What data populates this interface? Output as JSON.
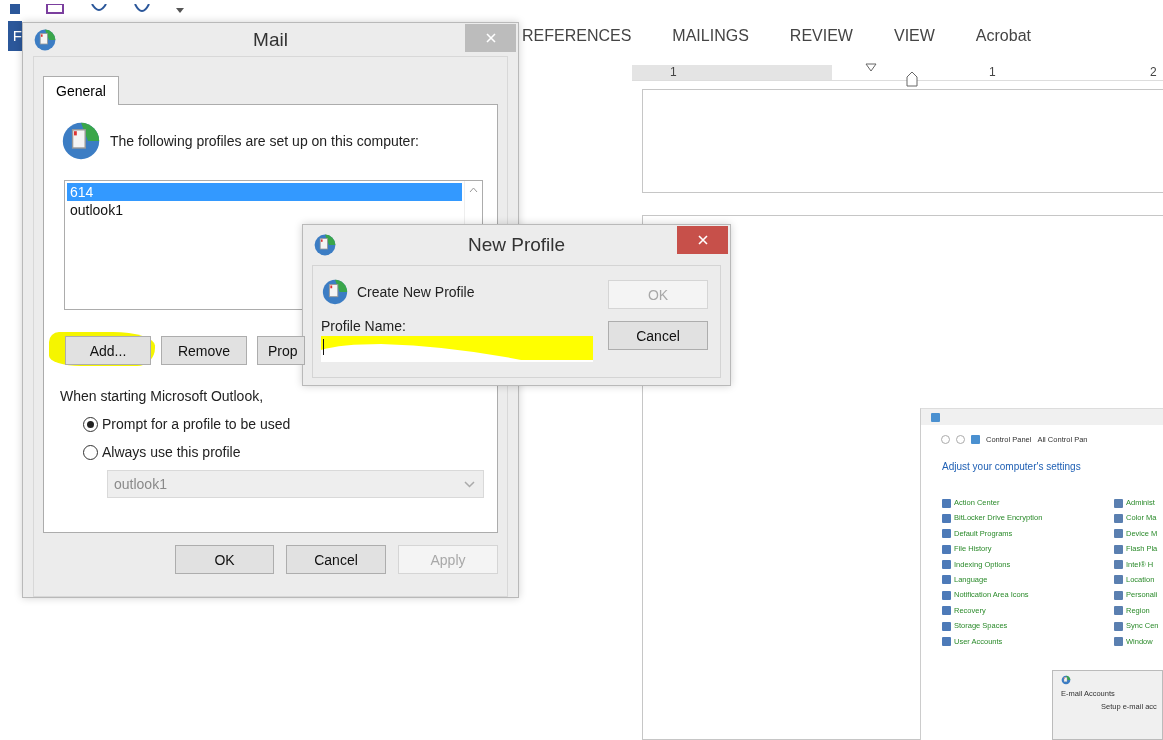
{
  "word": {
    "ribbon_tabs": [
      {
        "label": "F",
        "selected": true
      },
      {
        "label": "REFERENCES",
        "selected": false
      },
      {
        "label": "MAILINGS",
        "selected": false
      },
      {
        "label": "REVIEW",
        "selected": false
      },
      {
        "label": "VIEW",
        "selected": false
      },
      {
        "label": "Acrobat",
        "selected": false
      }
    ],
    "ruler_numbers": [
      "1",
      "1",
      "2"
    ]
  },
  "mail_dialog": {
    "title": "Mail",
    "active": false,
    "tabs": [
      {
        "label": "General",
        "selected": true
      }
    ],
    "intro": "The following profiles are set up on this computer:",
    "profiles": [
      {
        "name": "614",
        "selected": true
      },
      {
        "name": "outlook1",
        "selected": false
      }
    ],
    "buttons": [
      {
        "label": "Add...",
        "highlighted": true
      },
      {
        "label": "Remove",
        "highlighted": false
      },
      {
        "label": "Prop",
        "highlighted": false
      }
    ],
    "startup_label": "When starting Microsoft Outlook,",
    "options": [
      {
        "label": "Prompt for a profile to be used",
        "selected": true
      },
      {
        "label": "Always use this profile",
        "selected": false
      }
    ],
    "profile_select": {
      "value": "outlook1",
      "disabled": true
    },
    "footer_buttons": [
      {
        "label": "OK",
        "disabled": false
      },
      {
        "label": "Cancel",
        "disabled": false
      },
      {
        "label": "Apply",
        "disabled": true
      }
    ]
  },
  "new_profile_dialog": {
    "title": "New Profile",
    "active": true,
    "heading": "Create New Profile",
    "field_label": "Profile Name:",
    "field_highlighted": true,
    "buttons": [
      {
        "label": "OK",
        "disabled": true
      },
      {
        "label": "Cancel",
        "disabled": false
      }
    ]
  },
  "control_panel": {
    "address": [
      "Control Panel",
      "All Control Pan"
    ],
    "heading": "Adjust your computer's settings",
    "column_1": [
      "Action Center",
      "BitLocker Drive Encryption",
      "Default Programs",
      "File History",
      "Indexing Options",
      "Language",
      "Notification Area Icons",
      "Recovery",
      "Storage Spaces",
      "User Accounts"
    ],
    "column_2": [
      "Administ",
      "Color Ma",
      "Device M",
      "Flash Pla",
      "Intel® H",
      "Location",
      "Personali",
      "Region",
      "Sync Cen",
      "Window"
    ],
    "inner_window": {
      "section": "E-mail Accounts",
      "text": "Setup e-mail acc"
    }
  }
}
